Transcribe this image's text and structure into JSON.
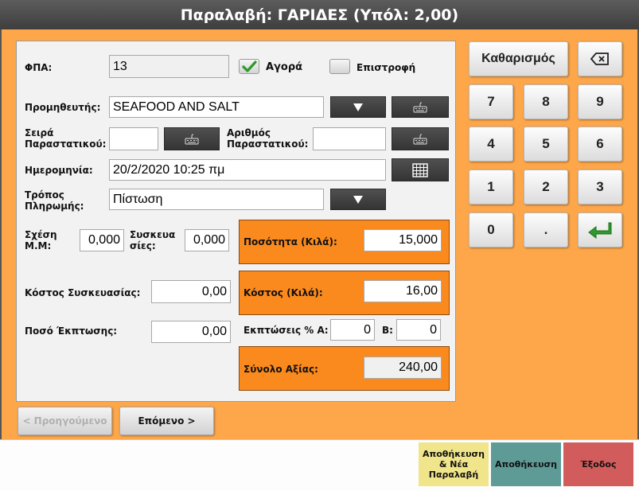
{
  "window": {
    "title": "Παραλαβή: ΓΑΡΙΔΕΣ (Υπόλ:  2,00)"
  },
  "form": {
    "vat_label": "ΦΠΑ:",
    "vat_value": "13",
    "purchase_label": "Αγορά",
    "purchase_checked": true,
    "return_label": "Επιστροφή",
    "return_checked": false,
    "supplier_label": "Προμηθευτής:",
    "supplier_value": "SEAFOOD AND SALT",
    "series_label": "Σειρά Παραστατικού:",
    "series_value": "",
    "docnum_label": "Αριθμός Παραστατικού:",
    "docnum_value": "",
    "date_label": "Ημερομηνία:",
    "date_value": "20/2/2020 10:25 πμ",
    "payment_label": "Τρόπος Πληρωμής:",
    "payment_value": "Πίστωση",
    "ratio_label": "Σχέση Μ.Μ:",
    "ratio_value": "0,000",
    "packs_label": "Συσκευασίες:",
    "packs_value": "0,000",
    "quantity_label": "Ποσότητα (Κιλά):",
    "quantity_value": "15,000",
    "pack_cost_label": "Κόστος Συσκευασίας:",
    "pack_cost_value": "0,00",
    "cost_label": "Κόστος (Κιλά):",
    "cost_value": "16,00",
    "discount_amount_label": "Ποσό Έκπτωσης:",
    "discount_amount_value": "0,00",
    "discount_pct_label": "Εκπτώσεις % Α:",
    "discount_a_value": "0",
    "discount_b_label": "Β:",
    "discount_b_value": "0",
    "total_label": "Σύνολο Αξίας:",
    "total_value": "240,00"
  },
  "keypad": {
    "clear_label": "Καθαρισμός",
    "keys": [
      "7",
      "8",
      "9",
      "4",
      "5",
      "6",
      "1",
      "2",
      "3",
      "0",
      "."
    ]
  },
  "nav": {
    "prev_label": "< Προηγούμενο",
    "next_label": "Επόμενο >"
  },
  "actions": {
    "save_new_label": "Αποθήκευση & Νέα Παραλαβή",
    "save_label": "Αποθήκευση",
    "exit_label": "Έξοδος"
  },
  "colors": {
    "background": "#fda64a",
    "highlight": "#fb8a1e",
    "save_new": "#f0e58a",
    "save": "#5e9b97",
    "exit": "#d25c5c",
    "enter_arrow": "#2e9a2e"
  },
  "icons": {
    "dropdown": "triangle-down-icon",
    "keyboard": "keyboard-icon",
    "calendar": "calendar-icon",
    "backspace": "backspace-icon",
    "enter": "enter-arrow-icon",
    "check": "checkmark-icon"
  }
}
